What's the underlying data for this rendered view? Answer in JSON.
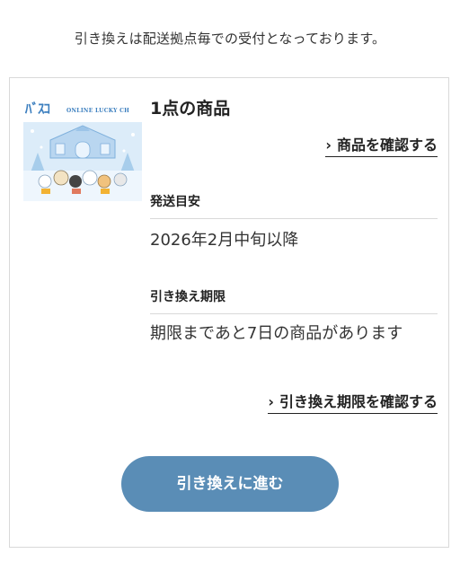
{
  "notice": "引き換えは配送拠点毎での受付となっております。",
  "product": {
    "image": {
      "logo_text": "ﾊﾞｽｺ",
      "caption": "ONLINE LUCKY CH",
      "sky_color": "#cfe4f7",
      "accent_color": "#3c7fbf"
    },
    "count_label": "1点の商品",
    "confirm_link": "商品を確認する"
  },
  "shipping": {
    "label": "発送目安",
    "value": "2026年2月中旬以降"
  },
  "deadline": {
    "label": "引き換え期限",
    "value": "期限まであと7日の商品があります",
    "confirm_link": "引き換え期限を確認する"
  },
  "action": {
    "button_label": "引き換えに進む",
    "button_color": "#5a8db6"
  },
  "icons": {
    "chevron": "›"
  }
}
